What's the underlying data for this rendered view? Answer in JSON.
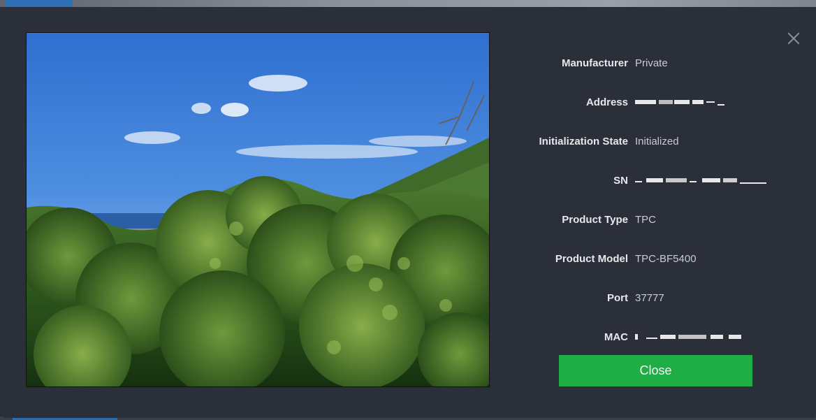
{
  "dialog": {
    "fields": [
      {
        "label": "Manufacturer",
        "value": "Private",
        "masked": false
      },
      {
        "label": "Address",
        "value": "",
        "masked": true
      },
      {
        "label": "Initialization State",
        "value": "Initialized",
        "masked": false
      },
      {
        "label": "SN",
        "value": "",
        "masked": true
      },
      {
        "label": "Product Type",
        "value": "TPC",
        "masked": false
      },
      {
        "label": "Product Model",
        "value": "TPC-BF5400",
        "masked": false
      },
      {
        "label": "Port",
        "value": "37777",
        "masked": false
      },
      {
        "label": "MAC",
        "value": "",
        "masked": true
      }
    ],
    "close_button_label": "Close"
  },
  "colors": {
    "dialog_background": "#2a2f39",
    "close_button": "#1fae46"
  },
  "icons": {
    "dismiss": "close-icon"
  }
}
